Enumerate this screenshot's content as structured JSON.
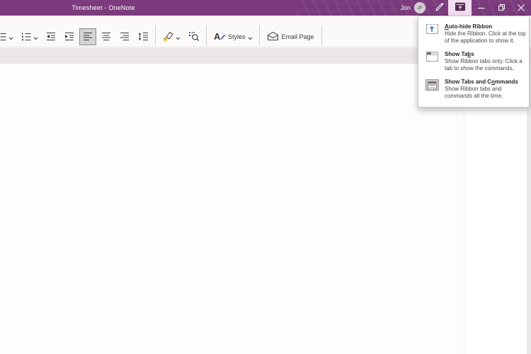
{
  "titlebar": {
    "title": "Timesheet - OneNote",
    "user": {
      "name": "Jon",
      "initials": "JF"
    }
  },
  "toolbar": {
    "styles_label": "Styles",
    "email_page_label": "Email Page"
  },
  "menu": {
    "items": [
      {
        "title_pre": "",
        "title_key": "A",
        "title_post": "uto-hide Ribbon",
        "desc_line1": "Hide the Ribbon. Click at the top",
        "desc_line2": "of the application to show it."
      },
      {
        "title_pre": "Show Ta",
        "title_key": "b",
        "title_post": "s",
        "desc_line1": "Show Ribbon tabs only. Click a",
        "desc_line2": "tab to show the commands."
      },
      {
        "title_pre": "Show Tabs and C",
        "title_key": "o",
        "title_post": "mmands",
        "desc_line1": "Show Ribbon tabs and",
        "desc_line2": "commands all the time."
      }
    ]
  },
  "colors": {
    "titlebar_bg": "#7b3b7d",
    "active_titlebar_button_bg": "#f2def1",
    "accent_blue": "#3a7bc8",
    "tag_star_gold": "#dfae2e"
  }
}
